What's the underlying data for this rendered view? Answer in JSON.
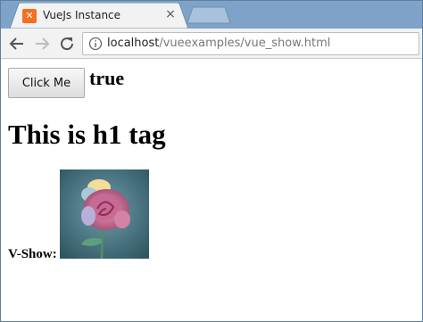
{
  "browser": {
    "tab": {
      "title": "VueJs Instance",
      "favicon_letter": "✕",
      "close_glyph": "×"
    },
    "address": {
      "host": "localhost",
      "path": "/vueexamples/vue_show.html"
    }
  },
  "page": {
    "button_label": "Click Me",
    "show_value": "true",
    "heading": "This is h1 tag",
    "vshow_label": "V-Show:"
  },
  "icons": {
    "back": "arrow-left-icon",
    "forward": "arrow-right-icon",
    "reload": "reload-icon",
    "info": "info-icon",
    "favicon": "xampp-favicon-icon"
  },
  "colors": {
    "tabstrip": "#7fa3c8",
    "favicon": "#f37021",
    "url_path": "#777777"
  }
}
